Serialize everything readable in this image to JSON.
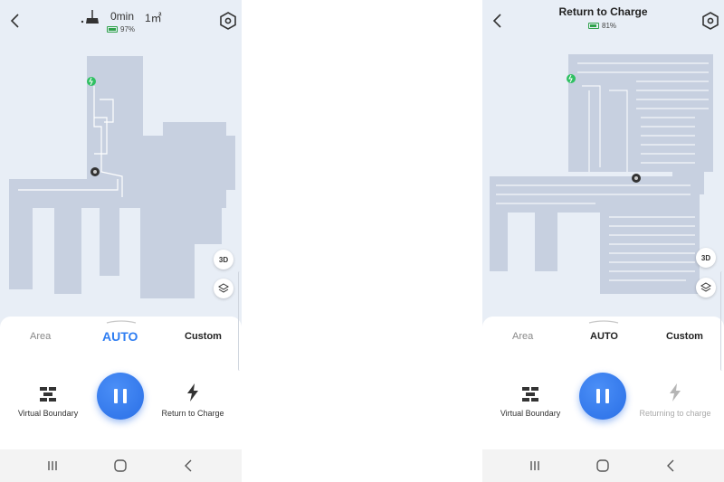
{
  "left": {
    "header": {
      "time": "0min",
      "area": "1㎡",
      "battery": "97%",
      "battery_level": 0.97
    },
    "modes": {
      "area": "Area",
      "auto": "AUTO",
      "custom": "Custom"
    },
    "controls": {
      "virtual_boundary": "Virtual Boundary",
      "return_to_charge": "Return to Charge"
    },
    "map_buttons": {
      "view_3d": "3D"
    }
  },
  "right": {
    "header": {
      "title": "Return to Charge",
      "battery": "81%",
      "battery_level": 0.81
    },
    "modes": {
      "area": "Area",
      "auto": "AUTO",
      "custom": "Custom"
    },
    "controls": {
      "virtual_boundary": "Virtual Boundary",
      "return_to_charge": "Returning to charge"
    },
    "map_buttons": {
      "view_3d": "3D"
    }
  },
  "colors": {
    "accent": "#2f7ef2",
    "map_floor": "#c7d0e0",
    "battery": "#2fa24a",
    "charger": "#2fc062"
  },
  "icons": [
    "back-chevron-icon",
    "settings-hexagon-icon",
    "broom-icon",
    "battery-icon",
    "charger-icon",
    "robot-icon",
    "3d-view-icon",
    "layers-icon",
    "virtual-boundary-icon",
    "lightning-icon",
    "pause-icon",
    "recent-apps-icon",
    "home-icon",
    "nav-back-icon"
  ]
}
